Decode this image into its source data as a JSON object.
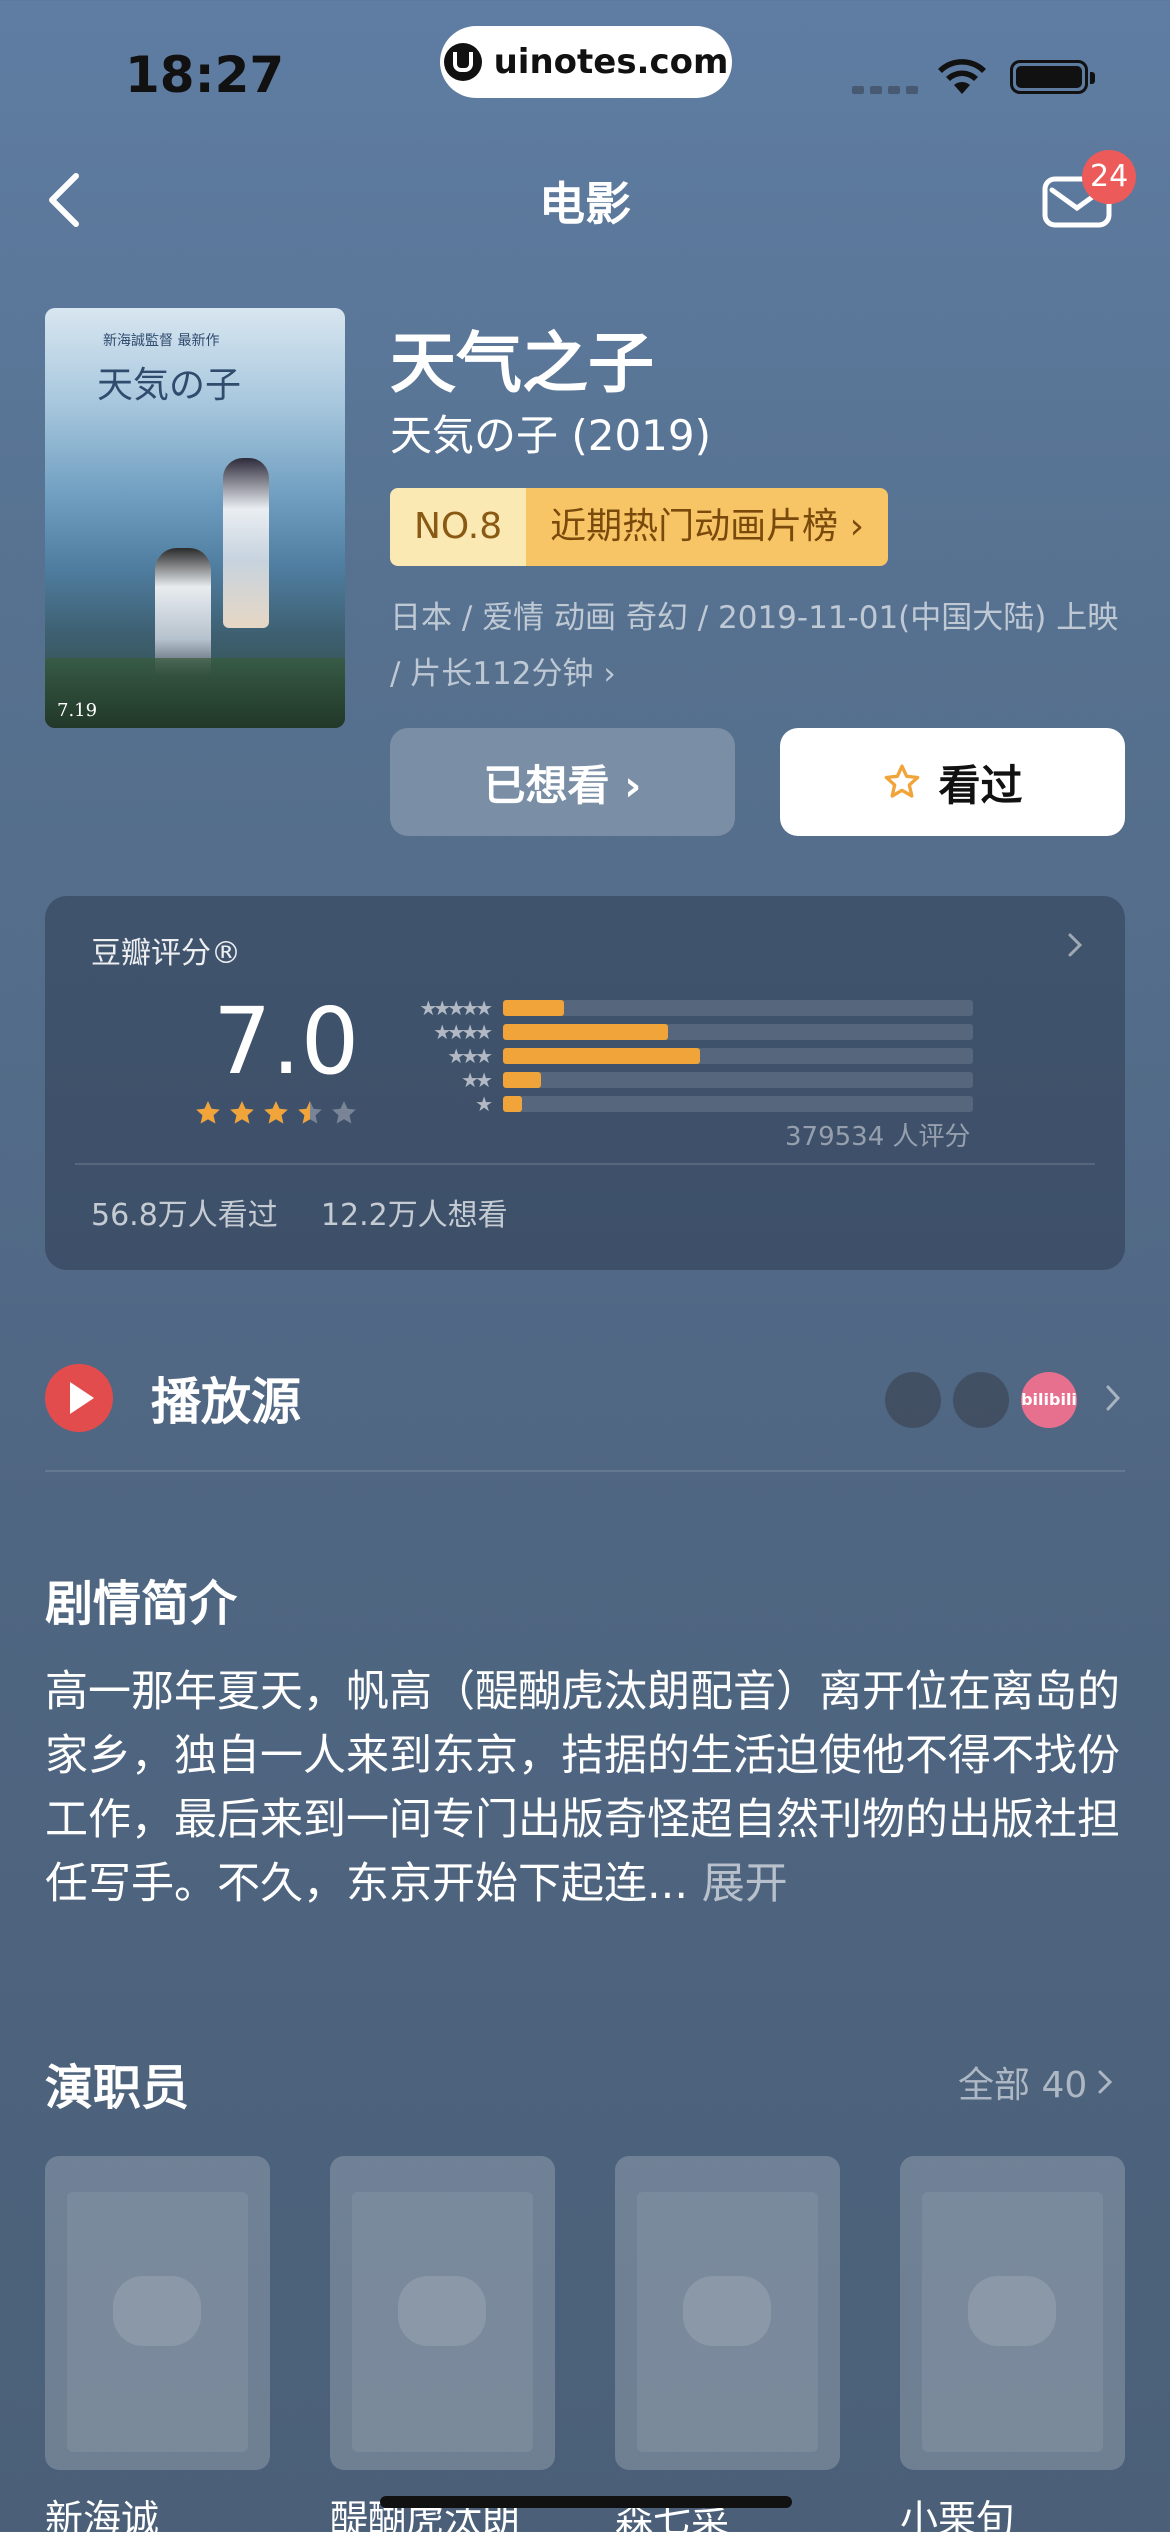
{
  "status_bar": {
    "time": "18:27",
    "url": "uinotes.com"
  },
  "nav": {
    "title": "电影",
    "badge_count": "24"
  },
  "movie": {
    "poster_title": "天気の子",
    "poster_subtitle": "新海誠監督 最新作",
    "poster_date": "7.19",
    "title": "天气之子",
    "original_title": "天気の子 (2019)",
    "rank_no": "NO.8",
    "rank_list": "近期热门动画片榜 ›",
    "meta": "日本 / 爱情 动画 奇幻 / 2019-11-01(中国大陆) 上映 / 片长112分钟 ›",
    "want_button": "已想看 ›",
    "seen_button": "看过"
  },
  "rating": {
    "label": "豆瓣评分®",
    "score": "7.0",
    "stars": 3.5,
    "distribution": [
      {
        "stars": "★★★★★",
        "percent": 13
      },
      {
        "stars": "★★★★",
        "percent": 35
      },
      {
        "stars": "★★★",
        "percent": 42
      },
      {
        "stars": "★★",
        "percent": 8
      },
      {
        "stars": "★",
        "percent": 4
      }
    ],
    "count": "379534 人评分",
    "watched": "56.8万人看过",
    "want": "12.2万人想看"
  },
  "play_source": {
    "label": "播放源",
    "platform_badge": "bilibili"
  },
  "synopsis": {
    "title": "剧情简介",
    "text": "高一那年夏天，帆高（醍醐虎汰朗配音）离开位在离岛的家乡，独自一人来到东京，拮据的生活迫使他不得不找份工作，最后来到一间专门出版奇怪超自然刊物的出版社担任写手。不久，东京开始下起连...",
    "more": "展开"
  },
  "cast": {
    "title": "演职员",
    "all": "全部 40",
    "people": [
      {
        "name": "新海诚"
      },
      {
        "name": "醍醐虎汰朗"
      },
      {
        "name": "森七菜"
      },
      {
        "name": "小栗旬"
      }
    ]
  },
  "colors": {
    "accent_orange": "#f1a43a",
    "badge_red": "#ec5a5a",
    "play_red": "#e34c4c"
  }
}
